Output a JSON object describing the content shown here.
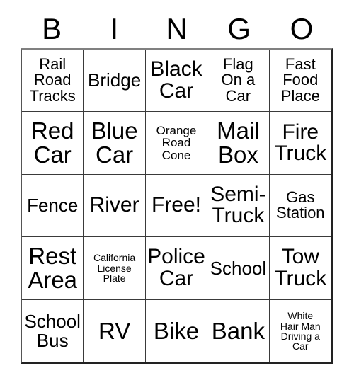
{
  "card": {
    "title": "BINGO",
    "header_letters": [
      "B",
      "I",
      "N",
      "G",
      "O"
    ],
    "free_space_label": "Free!",
    "colors": {
      "text": "#000000",
      "background": "#ffffff",
      "grid_line": "#3a3a3a",
      "outer_border": "#222222"
    },
    "grid": {
      "columns": 5,
      "rows": 5,
      "cells": [
        {
          "text": "Rail\nRoad\nTracks",
          "size": "m",
          "free": false
        },
        {
          "text": "Bridge",
          "size": "l",
          "free": false
        },
        {
          "text": "Black\nCar",
          "size": "xl",
          "free": false
        },
        {
          "text": "Flag\nOn a\nCar",
          "size": "m",
          "free": false
        },
        {
          "text": "Fast\nFood\nPlace",
          "size": "m",
          "free": false
        },
        {
          "text": "Red\nCar",
          "size": "xxl",
          "free": false
        },
        {
          "text": "Blue\nCar",
          "size": "xxl",
          "free": false
        },
        {
          "text": "Orange\nRoad\nCone",
          "size": "s",
          "free": false
        },
        {
          "text": "Mail\nBox",
          "size": "xxl",
          "free": false
        },
        {
          "text": "Fire\nTruck",
          "size": "xl",
          "free": false
        },
        {
          "text": "Fence",
          "size": "l",
          "free": false
        },
        {
          "text": "River",
          "size": "xl",
          "free": false
        },
        {
          "text": "Free!",
          "size": "xl",
          "free": true
        },
        {
          "text": "Semi-\nTruck",
          "size": "xl",
          "free": false
        },
        {
          "text": "Gas\nStation",
          "size": "m",
          "free": false
        },
        {
          "text": "Rest\nArea",
          "size": "xxl",
          "free": false
        },
        {
          "text": "California\nLicense\nPlate",
          "size": "xs",
          "free": false
        },
        {
          "text": "Police\nCar",
          "size": "xl",
          "free": false
        },
        {
          "text": "School",
          "size": "l",
          "free": false
        },
        {
          "text": "Tow\nTruck",
          "size": "xl",
          "free": false
        },
        {
          "text": "School\nBus",
          "size": "l",
          "free": false
        },
        {
          "text": "RV",
          "size": "xxl",
          "free": false
        },
        {
          "text": "Bike",
          "size": "xxl",
          "free": false
        },
        {
          "text": "Bank",
          "size": "xxl",
          "free": false
        },
        {
          "text": "White\nHair Man\nDriving a\nCar",
          "size": "xs",
          "free": false
        }
      ]
    }
  }
}
